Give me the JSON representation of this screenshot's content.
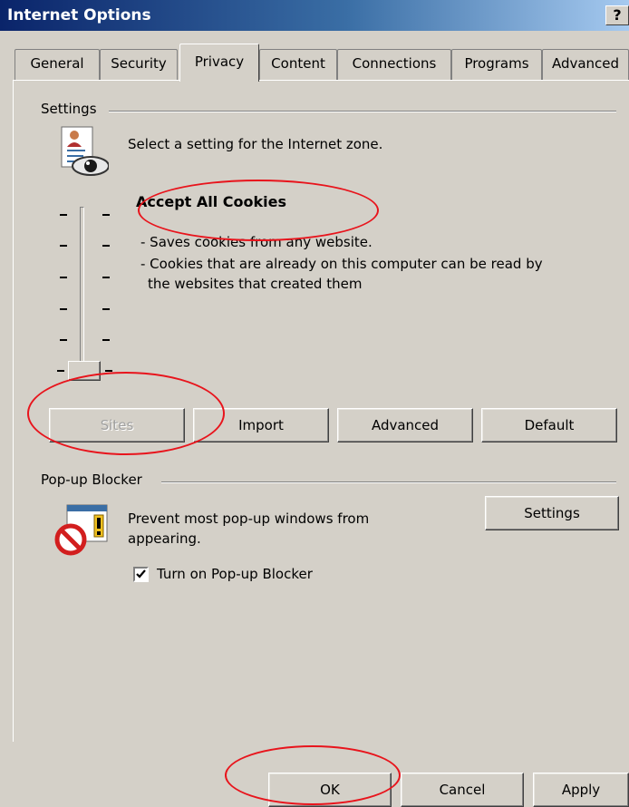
{
  "window": {
    "title": "Internet Options",
    "help_glyph": "?"
  },
  "tabs": [
    {
      "label": "General",
      "active": false
    },
    {
      "label": "Security",
      "active": false
    },
    {
      "label": "Privacy",
      "active": true
    },
    {
      "label": "Content",
      "active": false
    },
    {
      "label": "Connections",
      "active": false
    },
    {
      "label": "Programs",
      "active": false
    },
    {
      "label": "Advanced",
      "active": false
    }
  ],
  "settings": {
    "group_label": "Settings",
    "icon": "privacy-document-eye-icon",
    "zone_prompt": "Select a setting for the Internet zone.",
    "level_title": "Accept All Cookies",
    "level_desc_1": "- Saves cookies from any website.",
    "level_desc_2": "- Cookies that are already on this computer can be read by",
    "level_desc_3": "the websites that created them",
    "slider_level": 0,
    "slider_levels_total": 6
  },
  "buttons": {
    "sites": "Sites",
    "import": "Import",
    "advanced": "Advanced",
    "default": "Default"
  },
  "popup": {
    "group_label": "Pop-up Blocker",
    "icon": "popup-blocked-icon",
    "desc_1": "Prevent most pop-up windows from",
    "desc_2": "appearing.",
    "settings_button": "Settings",
    "checkbox_label": "Turn on Pop-up Blocker",
    "checkbox_checked": true
  },
  "footer": {
    "ok": "OK",
    "cancel": "Cancel",
    "apply": "Apply"
  },
  "colors": {
    "annotation": "#e8141c",
    "titlebar_start": "#0a246a",
    "titlebar_end": "#a6caf0"
  }
}
